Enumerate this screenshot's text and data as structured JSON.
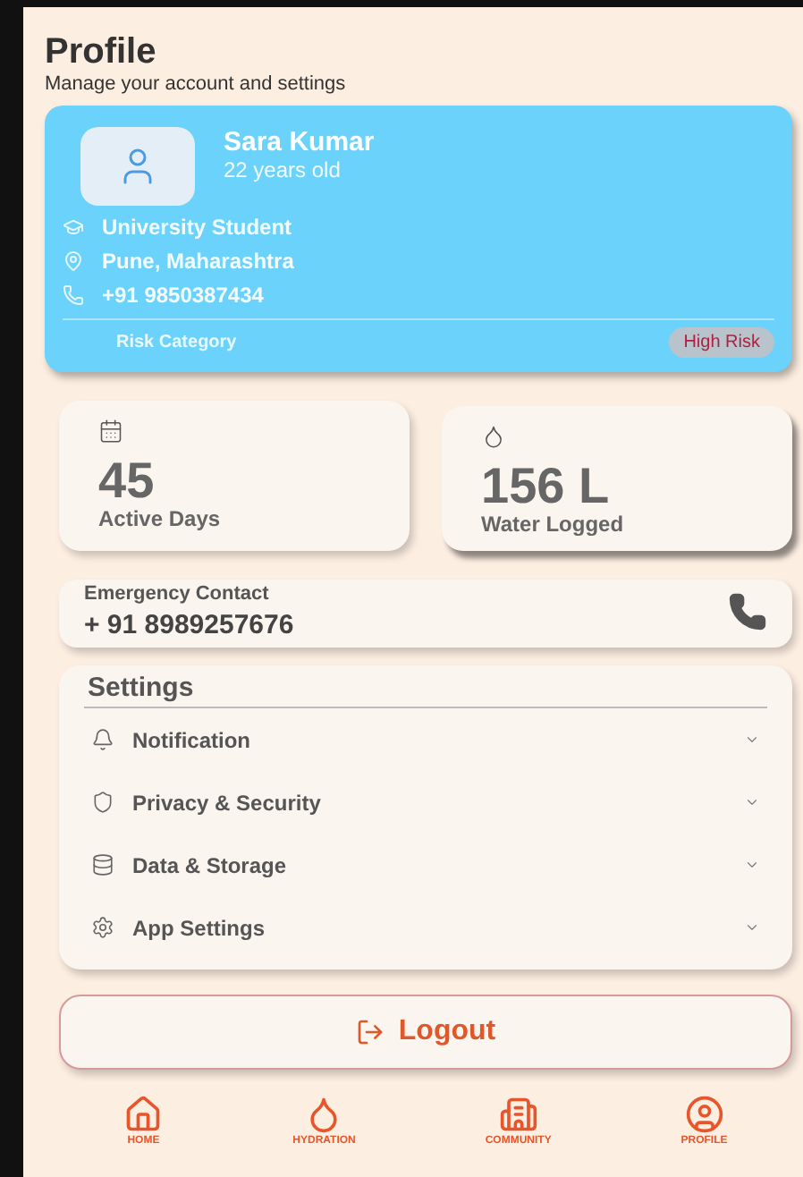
{
  "header": {
    "title": "Profile",
    "subtitle": "Manage your account and settings"
  },
  "profile": {
    "name": "Sara Kumar",
    "age": "22 years old",
    "details": [
      {
        "kind": "education",
        "text": "University Student"
      },
      {
        "kind": "location",
        "text": "Pune, Maharashtra"
      },
      {
        "kind": "phone",
        "text": "+91 9850387434"
      }
    ],
    "risk_label": "Risk Category",
    "risk_badge": "High Risk"
  },
  "stats": [
    {
      "kind": "calendar",
      "value": "45",
      "label": "Active Days"
    },
    {
      "kind": "drop",
      "value": "156 L",
      "label": "Water Logged"
    }
  ],
  "emergency": {
    "label": "Emergency Contact",
    "number": "+ 91 8989257676"
  },
  "settings": {
    "title": "Settings",
    "items": [
      {
        "kind": "bell",
        "label": "Notification",
        "expanded": false
      },
      {
        "kind": "shield",
        "label": "Privacy & Security",
        "expanded": false
      },
      {
        "kind": "database",
        "label": "Data & Storage",
        "expanded": false
      },
      {
        "kind": "gear",
        "label": "App Settings",
        "expanded": false
      }
    ]
  },
  "logout": "Logout",
  "nav": [
    {
      "kind": "home",
      "label": "HOME"
    },
    {
      "kind": "drop",
      "label": "HYDRATION"
    },
    {
      "kind": "community",
      "label": "COMMUNITY"
    },
    {
      "kind": "profile",
      "label": "PROFILE"
    }
  ]
}
